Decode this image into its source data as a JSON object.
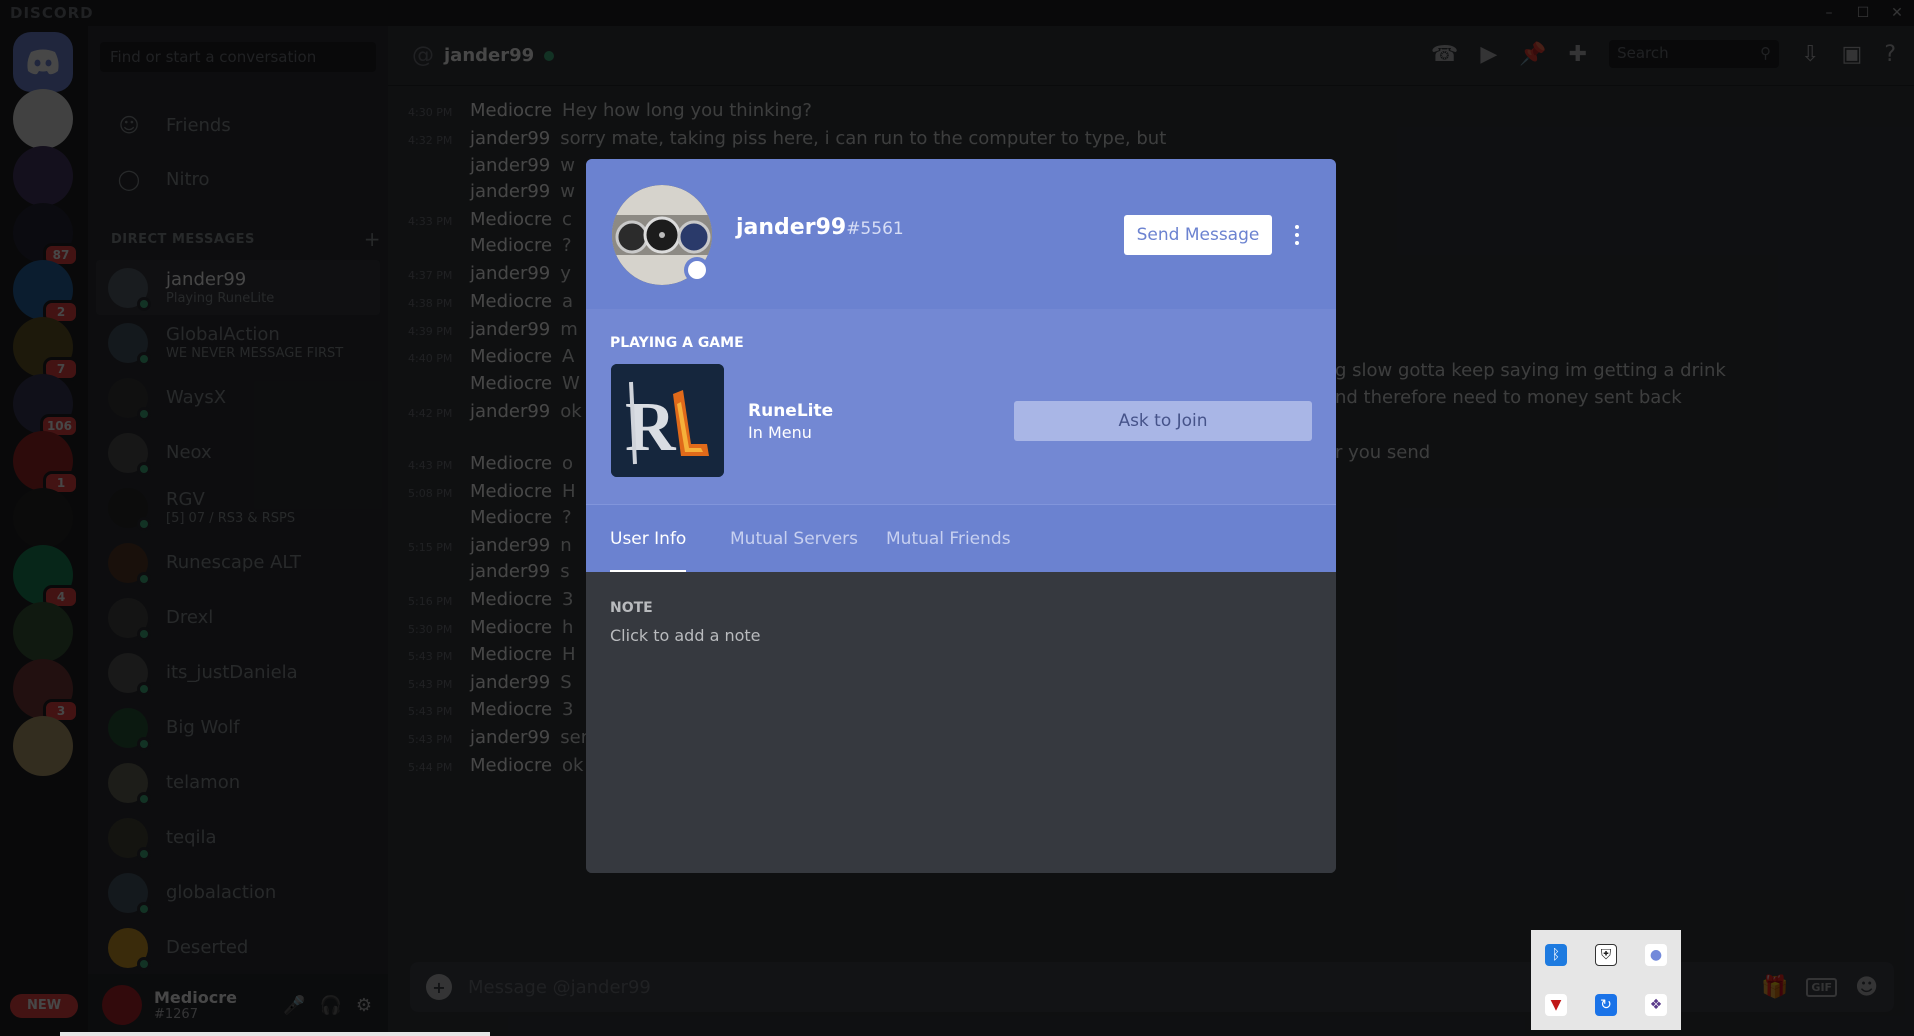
{
  "app": {
    "brand": "DISCORD"
  },
  "window_controls": {
    "minimize": "–",
    "maximize": "☐",
    "close": "✕"
  },
  "servers": [
    {
      "name": "home",
      "badge": ""
    },
    {
      "name": "beta",
      "badge": ""
    },
    {
      "name": "s2",
      "badge": ""
    },
    {
      "name": "s3",
      "badge": "87"
    },
    {
      "name": "s4",
      "badge": "2"
    },
    {
      "name": "s5",
      "badge": "7"
    },
    {
      "name": "s6",
      "badge": "106"
    },
    {
      "name": "s7",
      "badge": "1"
    },
    {
      "name": "s8",
      "badge": ""
    },
    {
      "name": "s9",
      "badge": "4"
    },
    {
      "name": "s10",
      "badge": ""
    },
    {
      "name": "s11",
      "badge": "3"
    },
    {
      "name": "s12",
      "badge": ""
    }
  ],
  "new_tag": "NEW",
  "dm_sidebar": {
    "search_placeholder": "Find or start a conversation",
    "friends_label": "Friends",
    "nitro_label": "Nitro",
    "header": "DIRECT MESSAGES",
    "add_symbol": "+",
    "items": [
      {
        "name": "jander99",
        "sub": "Playing RuneLite",
        "active": true,
        "color": "#5b6470"
      },
      {
        "name": "GlobalAction",
        "sub": "WE NEVER MESSAGE FIRST",
        "active": false,
        "color": "#4a5b6a"
      },
      {
        "name": "WaysX",
        "sub": "",
        "active": false,
        "color": "#3a3a3a"
      },
      {
        "name": "Neox",
        "sub": "",
        "active": false,
        "color": "#555"
      },
      {
        "name": "RGV",
        "sub": "[5] 07 / RS3 & RSPS",
        "active": false,
        "color": "#2b2b2b"
      },
      {
        "name": "Runescape ALT",
        "sub": "",
        "active": false,
        "color": "#5a3a2a"
      },
      {
        "name": "Drexl",
        "sub": "",
        "active": false,
        "color": "#4a4a4a"
      },
      {
        "name": "its_justDaniela",
        "sub": "",
        "active": false,
        "color": "#5a5a5a"
      },
      {
        "name": "Big Wolf",
        "sub": "",
        "active": false,
        "color": "#2a5a3a"
      },
      {
        "name": "telamon",
        "sub": "",
        "active": false,
        "color": "#6a6a5a"
      },
      {
        "name": "teqila",
        "sub": "",
        "active": false,
        "color": "#4a4a3a"
      },
      {
        "name": "globalaction",
        "sub": "",
        "active": false,
        "color": "#4a5b6a"
      },
      {
        "name": "Deserted",
        "sub": "",
        "active": false,
        "color": "#d09a2a"
      }
    ],
    "user": {
      "name": "Mediocre",
      "tag": "#1267"
    }
  },
  "chat": {
    "recipient": "jander99",
    "search_placeholder": "Search",
    "composer_placeholder": "Message @jander99",
    "gif_label": "GIF",
    "messages": [
      {
        "ts": "4:30 PM",
        "author": "Mediocre",
        "text": "Hey how long you thinking?"
      },
      {
        "ts": "4:32 PM",
        "author": "jander99",
        "text": "sorry mate, taking piss here, i can run to the computer to type, but"
      },
      {
        "ts": "",
        "author": "jander99",
        "text": "w"
      },
      {
        "ts": "",
        "author": "jander99",
        "text": "w"
      },
      {
        "ts": "4:33 PM",
        "author": "Mediocre",
        "text": "c"
      },
      {
        "ts": "",
        "author": "Mediocre",
        "text": "?"
      },
      {
        "ts": "4:37 PM",
        "author": "jander99",
        "text": "y"
      },
      {
        "ts": "4:38 PM",
        "author": "Mediocre",
        "text": "a"
      },
      {
        "ts": "4:39 PM",
        "author": "jander99",
        "text": "m"
      },
      {
        "ts": "4:40 PM",
        "author": "Mediocre",
        "text": "A"
      },
      {
        "ts": "",
        "author": "Mediocre",
        "text": "W"
      },
      {
        "ts": "4:42 PM",
        "author": "jander99",
        "text": "ok"
      },
      {
        "ts": "4:43 PM",
        "author": "Mediocre",
        "text": "o"
      },
      {
        "ts": "5:08 PM",
        "author": "Mediocre",
        "text": "H"
      },
      {
        "ts": "",
        "author": "Mediocre",
        "text": "?"
      },
      {
        "ts": "5:15 PM",
        "author": "jander99",
        "text": "n"
      },
      {
        "ts": "",
        "author": "jander99",
        "text": "s"
      },
      {
        "ts": "5:16 PM",
        "author": "Mediocre",
        "text": "3"
      },
      {
        "ts": "5:30 PM",
        "author": "Mediocre",
        "text": "h"
      },
      {
        "ts": "5:43 PM",
        "author": "Mediocre",
        "text": "H"
      },
      {
        "ts": "5:43 PM",
        "author": "jander99",
        "text": "S"
      },
      {
        "ts": "5:43 PM",
        "author": "Mediocre",
        "text": "3"
      },
      {
        "ts": "5:43 PM",
        "author": "jander99",
        "text": "sending now"
      },
      {
        "ts": "5:44 PM",
        "author": "Mediocre",
        "text": "ok"
      }
    ],
    "right_fragments": [
      "g slow gotta keep saying im getting a drink",
      "nd therefore need to money sent back",
      "r you send"
    ]
  },
  "profile": {
    "username": "jander99",
    "discriminator": "#5561",
    "send_message": "Send Message",
    "activity_header": "PLAYING A GAME",
    "game_name": "RuneLite",
    "game_state": "In Menu",
    "ask_to_join": "Ask to Join",
    "tabs": [
      "User Info",
      "Mutual Servers",
      "Mutual Friends"
    ],
    "note_label": "NOTE",
    "note_placeholder": "Click to add a note"
  },
  "colors": {
    "blurple": "#7289da",
    "modal_header": "#6b82d0",
    "online": "#43b581",
    "badge": "#f04747"
  }
}
